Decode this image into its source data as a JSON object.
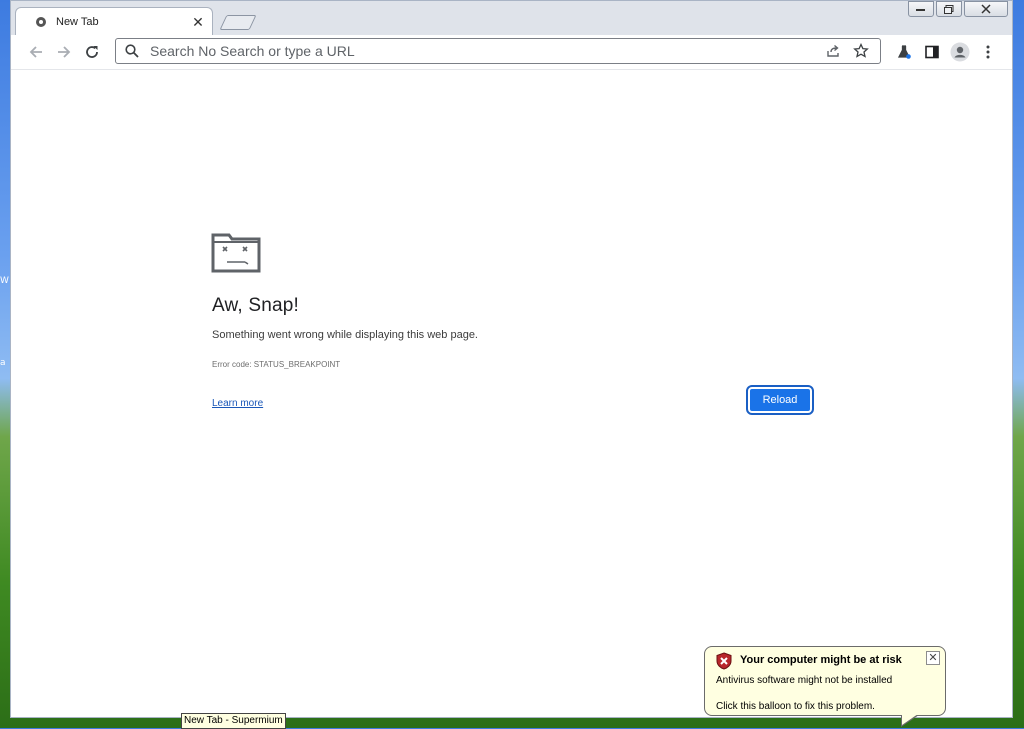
{
  "desktop": {
    "edge_text_1": "W",
    "edge_text_2": "a"
  },
  "browser": {
    "tab": {
      "title": "New Tab"
    },
    "omnibox": {
      "placeholder": "Search No Search or type a URL"
    }
  },
  "error_page": {
    "title": "Aw, Snap!",
    "message": "Something went wrong while displaying this web page.",
    "error_code": "Error code: STATUS_BREAKPOINT",
    "learn_more": "Learn more",
    "reload_label": "Reload"
  },
  "taskbar_tooltip": "New Tab - Supermium",
  "balloon": {
    "title": "Your computer might be at risk",
    "line1": "Antivirus software might not be installed",
    "line2": "Click this balloon to fix this problem."
  },
  "colors": {
    "accent": "#1a73e8",
    "link": "#1a57b8",
    "balloon_bg": "#ffffe1"
  }
}
